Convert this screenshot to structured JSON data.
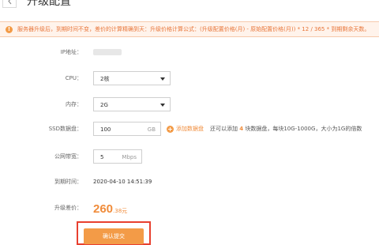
{
  "header": {
    "title": "升级配置"
  },
  "notice": {
    "text": "服务器升级后，到期时间不变，差价的计算精确到天：升级价格计算公式：(升级配置价格(月) - 原始配置价格(月)) * 12 / 365 * 到期剩余天数。"
  },
  "form": {
    "ip": {
      "label": "IP地址："
    },
    "cpu": {
      "label": "CPU：",
      "value": "2核"
    },
    "memory": {
      "label": "内存：",
      "value": "2G"
    },
    "ssd": {
      "label": "SSD数据盘：",
      "value": "100",
      "unit": "GB",
      "add_label": "添加数据盘",
      "hint_prefix": "还可以添加",
      "hint_count": "4",
      "hint_suffix": "块数据盘，每块10G-1000G，大小为1G的倍数"
    },
    "bandwidth": {
      "label": "公网带宽：",
      "value": "5",
      "unit": "Mbps"
    },
    "expire": {
      "label": "到期时间：",
      "value": "2020-04-10 14:51:39"
    },
    "price": {
      "label": "升级差价：",
      "main": "260",
      "sub": ".38元"
    }
  },
  "actions": {
    "confirm_label": "确认提交"
  },
  "colors": {
    "accent": "#f39b47",
    "highlight_border": "#e8402f",
    "notice_bg": "#fff3eb"
  },
  "icons": {
    "back": "chevron-left-icon",
    "notice": "warning-icon",
    "add": "plus-circle-icon",
    "select": "caret-down-icon"
  }
}
